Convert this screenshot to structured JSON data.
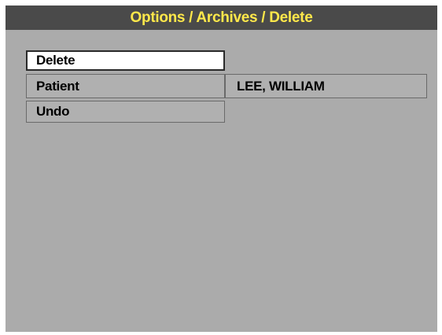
{
  "header": {
    "title": "Options / Archives / Delete"
  },
  "menu": {
    "items": [
      {
        "label": "Delete",
        "selected": true
      },
      {
        "label": "Patient",
        "selected": false
      },
      {
        "label": "Undo",
        "selected": false
      }
    ]
  },
  "patient": {
    "name": "LEE, WILLIAM"
  },
  "colors": {
    "title_text": "#ffe84a",
    "title_bar": "#4a4a4a",
    "background": "#ababab",
    "selected_item": "#ffffff"
  }
}
